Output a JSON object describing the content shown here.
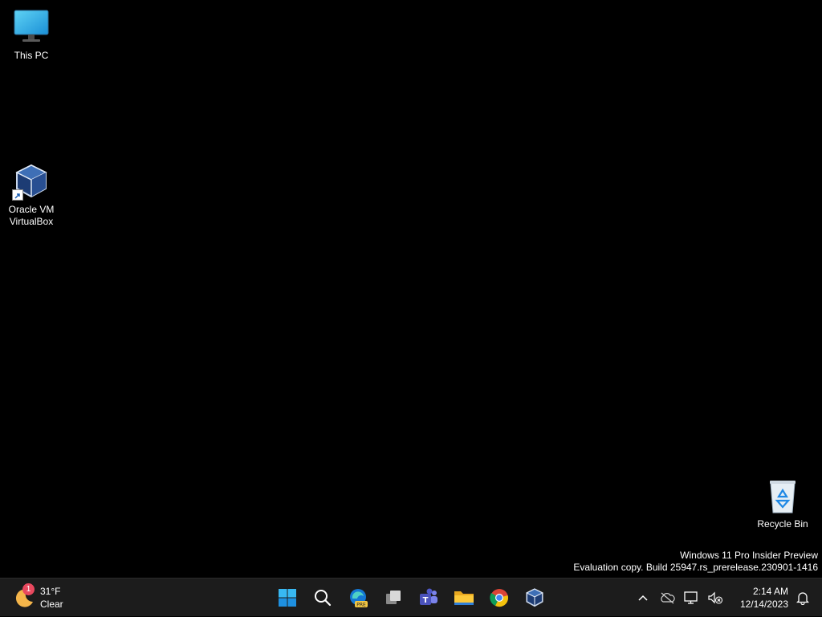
{
  "desktop": {
    "icons": [
      {
        "label": "This PC",
        "icon": "monitor-icon"
      },
      {
        "label": "Oracle VM\nVirtualBox",
        "icon": "virtualbox-icon"
      },
      {
        "label": "Recycle Bin",
        "icon": "recycle-bin-icon"
      }
    ],
    "watermark": {
      "line1": "Windows 11 Pro Insider Preview",
      "line2": "Evaluation copy. Build 25947.rs_prerelease.230901-1416"
    }
  },
  "taskbar": {
    "weather": {
      "temp": "31°F",
      "condition": "Clear",
      "badge": "1",
      "icon": "moon-icon"
    },
    "apps": [
      {
        "name": "Start",
        "icon": "windows-start-icon"
      },
      {
        "name": "Search",
        "icon": "search-icon"
      },
      {
        "name": "Microsoft Edge Preview",
        "icon": "edge-pre-icon"
      },
      {
        "name": "Task View",
        "icon": "task-view-icon"
      },
      {
        "name": "Microsoft Teams",
        "icon": "teams-icon"
      },
      {
        "name": "File Explorer",
        "icon": "folder-icon"
      },
      {
        "name": "Google Chrome",
        "icon": "chrome-icon"
      },
      {
        "name": "Oracle VM VirtualBox",
        "icon": "virtualbox-icon"
      }
    ],
    "tray": {
      "icons": [
        "chevron-up-icon",
        "onedrive-offline-icon",
        "network-icon",
        "volume-muted-icon"
      ],
      "time": "2:14 AM",
      "date": "12/14/2023",
      "notification_icon": "bell-icon"
    }
  },
  "colors": {
    "desktop_bg": "#000000",
    "taskbar_bg": "#1c1c1c",
    "accent": "#0078d4"
  }
}
